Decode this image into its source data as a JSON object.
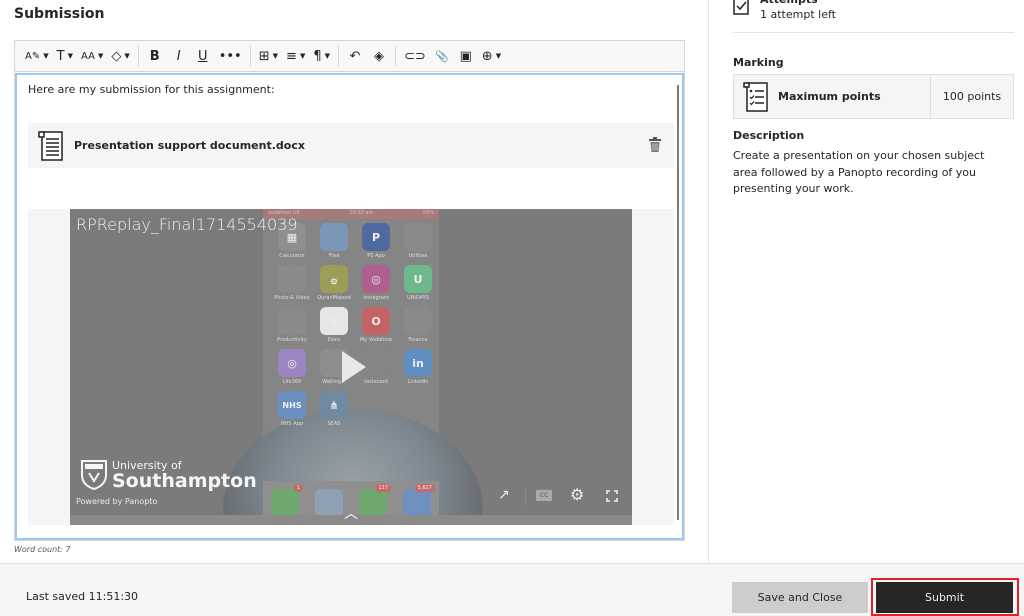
{
  "main": {
    "title": "Submission",
    "toolbar": [
      {
        "name": "text-style-button",
        "glyph": "A✎",
        "caret": true
      },
      {
        "name": "font-button",
        "glyph": "T",
        "caret": true
      },
      {
        "name": "font-size-button",
        "glyph": "AA",
        "caret": true
      },
      {
        "name": "highlight-button",
        "glyph": "◇",
        "caret": true
      },
      {
        "sep": true
      },
      {
        "name": "bold-button",
        "glyph": "B",
        "caret": false
      },
      {
        "name": "italic-button",
        "glyph": "I",
        "caret": false
      },
      {
        "name": "underline-button",
        "glyph": "U",
        "caret": false
      },
      {
        "name": "more-button",
        "glyph": "•••",
        "caret": false
      },
      {
        "sep": true
      },
      {
        "name": "table-button",
        "glyph": "⊞",
        "caret": true
      },
      {
        "name": "align-button",
        "glyph": "≡",
        "caret": true
      },
      {
        "name": "paragraph-button",
        "glyph": "¶",
        "caret": true
      },
      {
        "sep": true
      },
      {
        "name": "undo-button",
        "glyph": "↶",
        "caret": false
      },
      {
        "name": "clear-format-button",
        "glyph": "◈",
        "caret": false
      },
      {
        "sep": true
      },
      {
        "name": "link-button",
        "glyph": "⊂⊃",
        "caret": false
      },
      {
        "name": "attach-button",
        "glyph": "📎",
        "caret": false
      },
      {
        "name": "image-button",
        "glyph": "▣",
        "caret": false
      },
      {
        "name": "insert-button",
        "glyph": "⊕",
        "caret": true
      }
    ],
    "intro_text": "Here are my submission for this assignment:",
    "attachment": {
      "file_name": "Presentation support document.docx"
    },
    "video": {
      "title": "RPReplay_Final1714554039",
      "status_bar": {
        "carrier": "vodafone UK",
        "time": "10:30 am",
        "battery": "59%"
      },
      "apps": [
        {
          "label": "Calculator",
          "color": "#8f8f8f",
          "glyph": "▦"
        },
        {
          "label": "Files",
          "color": "#7b97b8",
          "glyph": ""
        },
        {
          "label": "PS App",
          "color": "#4f6aa0",
          "glyph": "P"
        },
        {
          "label": "Utilities",
          "color": "#8a8a8a",
          "glyph": ""
        },
        {
          "label": "Photo & Video",
          "color": "#8a8a8a",
          "glyph": ""
        },
        {
          "label": "QuranMajeed",
          "color": "#9c9d57",
          "glyph": "۞"
        },
        {
          "label": "Instagram",
          "color": "#b0608f",
          "glyph": "◎"
        },
        {
          "label": "UNiDAYS",
          "color": "#6db98c",
          "glyph": "U"
        },
        {
          "label": "Productivity",
          "color": "#8a8a8a",
          "glyph": ""
        },
        {
          "label": "Docs",
          "color": "#e6e6e6",
          "glyph": "≡"
        },
        {
          "label": "My Vodafone",
          "color": "#c36464",
          "glyph": "O"
        },
        {
          "label": "Finance",
          "color": "#8a8a8a",
          "glyph": ""
        },
        {
          "label": "Life360",
          "color": "#9c86c2",
          "glyph": "◎"
        },
        {
          "label": "Waiting...",
          "color": "#8d8d8d",
          "glyph": ""
        },
        {
          "label": "tastecard",
          "color": "#858585",
          "glyph": ""
        },
        {
          "label": "LinkedIn",
          "color": "#5f8fc0",
          "glyph": "in"
        },
        {
          "label": "NHS App",
          "color": "#6c8fc2",
          "glyph": "NHS"
        },
        {
          "label": "SEAS",
          "color": "#6f8aa2",
          "glyph": "⋔"
        }
      ],
      "dock": [
        {
          "name": "phone",
          "color": "#6fa86f",
          "badge": "1"
        },
        {
          "name": "safari",
          "color": "#8fa0b5",
          "badge": ""
        },
        {
          "name": "messages",
          "color": "#6fa86f",
          "badge": "117"
        },
        {
          "name": "mail",
          "color": "#6f8fc0",
          "badge": "5,627"
        }
      ],
      "logo_small": "University of",
      "logo_big": "Southampton",
      "powered_by": "Powered by Panopto",
      "cc_label": "CC"
    },
    "word_count": "Word count: 7"
  },
  "sidebar": {
    "attempts_title": "Attempts",
    "attempts_value": "1 attempt left",
    "marking_heading": "Marking",
    "marking_label": "Maximum points",
    "marking_value": "100 points",
    "description_heading": "Description",
    "description_text": "Create a presentation on your chosen subject area followed by a Panopto recording of you presenting your work."
  },
  "footer": {
    "last_saved": "Last saved 11:51:30",
    "save_close_label": "Save and Close",
    "submit_label": "Submit",
    "highlight_color": "#e0202a"
  }
}
